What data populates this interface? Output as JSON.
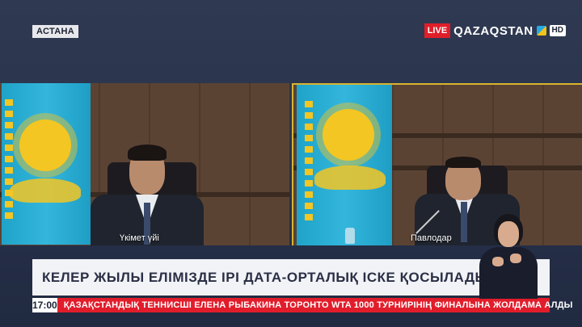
{
  "location_tag": "АСТАНА",
  "brand": {
    "live_label": "LIVE",
    "channel_name": "QAZAQSTAN",
    "quality_badge": "HD"
  },
  "panels": {
    "left": {
      "caption": "Үкімет үйі"
    },
    "right": {
      "caption": "Павлодар"
    }
  },
  "headline": "КЕЛЕР ЖЫЛЫ ЕЛІМІЗДЕ ІРІ ДАТА-ОРТАЛЫҚ ІСКЕ ҚОСЫЛАДЫ",
  "ticker": {
    "time": "17:00",
    "text": "ҚАЗАҚСТАНДЫҚ ТЕННИСШІ ЕЛЕНА РЫБАКИНА ТОРОНТО WTA 1000 ТУРНИРІНІҢ ФИНАЛЫНА ЖОЛДАМА АЛДЫ"
  },
  "colors": {
    "live_red": "#e01e2a",
    "ticker_red": "#e21d2b",
    "frame_gold": "#d8b431",
    "flag_blue": "#1fa3c9",
    "sun_yellow": "#f3c623"
  }
}
